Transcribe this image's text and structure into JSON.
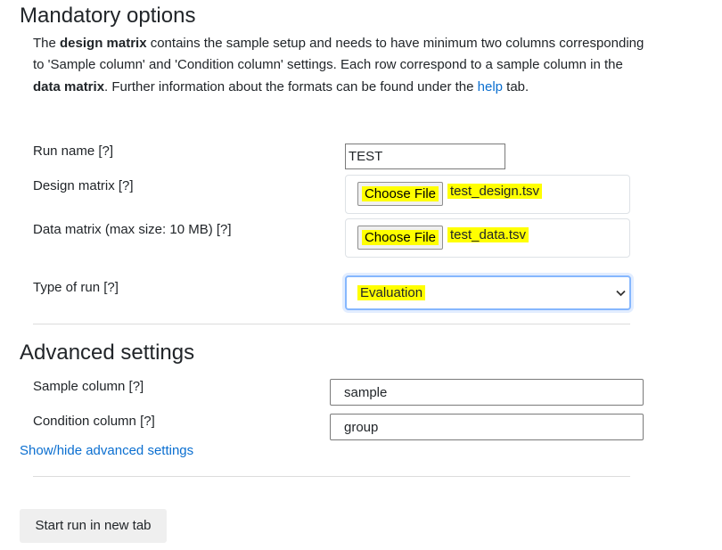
{
  "mandatory": {
    "heading": "Mandatory options",
    "description": {
      "p1": "The ",
      "b1": "design matrix",
      "p2": " contains the sample setup and needs to have minimum two columns corresponding to 'Sample column' and 'Condition column' settings. Each row correspond to a sample column in the ",
      "b2": "data matrix",
      "p3": ". Further information about the formats can be found under the ",
      "link": "help",
      "p4": " tab."
    },
    "run_name": {
      "label": "Run name [?]",
      "value": "TEST"
    },
    "design_matrix": {
      "label": "Design matrix [?]",
      "button": "Choose File",
      "file": "test_design.tsv"
    },
    "data_matrix": {
      "label": "Data matrix (max size: 10 MB) [?]",
      "button": "Choose File",
      "file": "test_data.tsv"
    },
    "type_of_run": {
      "label": "Type of run [?]",
      "selected": "Evaluation"
    }
  },
  "advanced": {
    "heading": "Advanced settings",
    "sample_column": {
      "label": "Sample column [?]",
      "value": "sample"
    },
    "condition_column": {
      "label": "Condition column [?]",
      "value": "group"
    },
    "toggle_link": "Show/hide advanced settings"
  },
  "start_button": "Start run in new tab",
  "colors": {
    "highlight": "#ffff00",
    "link": "#0b6fd0",
    "focus": "#86b7fe"
  },
  "icons": {
    "select_arrow": "chevron-down-icon"
  }
}
